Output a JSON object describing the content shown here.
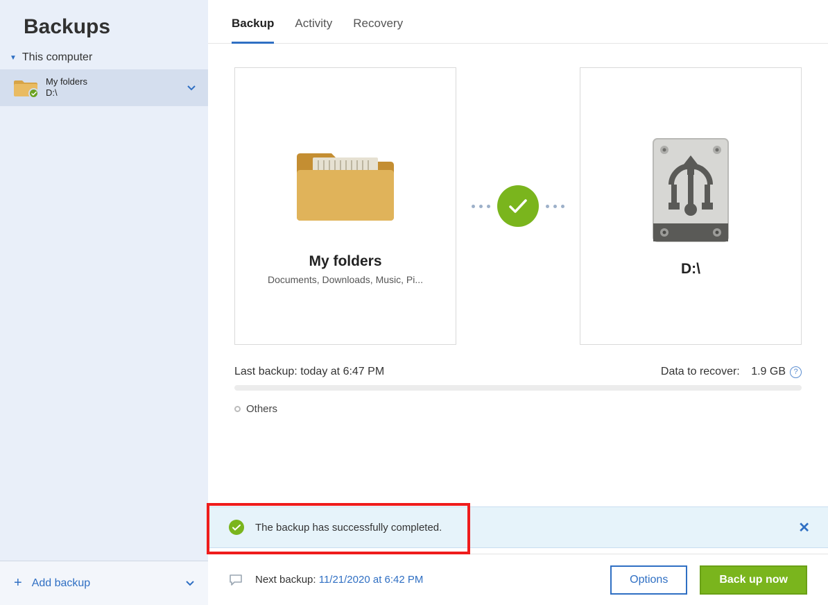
{
  "sidebar": {
    "title": "Backups",
    "section_label": "This computer",
    "item": {
      "name": "My folders",
      "location": "D:\\"
    },
    "add_backup_label": "Add backup"
  },
  "tabs": {
    "backup": "Backup",
    "activity": "Activity",
    "recovery": "Recovery"
  },
  "source": {
    "title": "My folders",
    "subtitle": "Documents, Downloads, Music, Pi..."
  },
  "destination": {
    "title": "D:\\"
  },
  "last_backup_label": "Last backup:",
  "last_backup_value": "today at 6:47 PM",
  "data_to_recover_label": "Data to recover:",
  "data_to_recover_value": "1.9 GB",
  "others_label": "Others",
  "notification_text": "The backup has successfully completed.",
  "next_backup_label": "Next backup:",
  "next_backup_value": "11/21/2020 at 6:42 PM",
  "buttons": {
    "options": "Options",
    "back_up_now": "Back up now"
  }
}
